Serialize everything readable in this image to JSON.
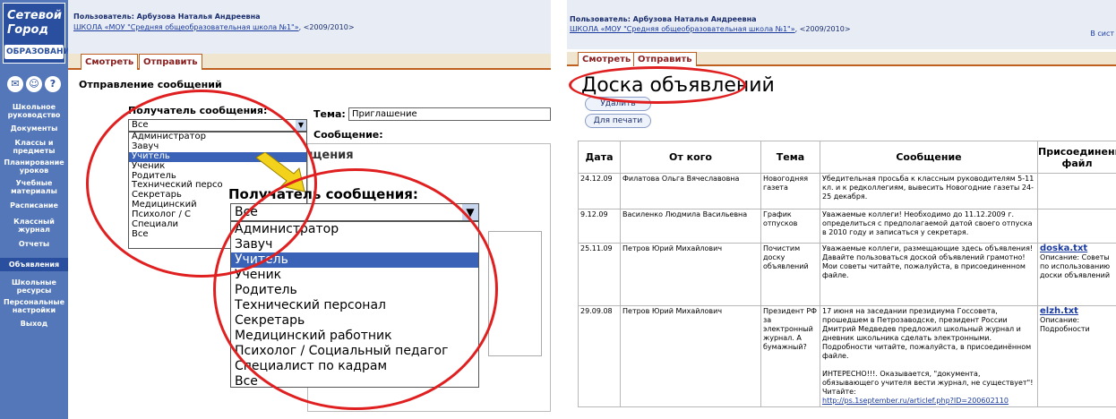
{
  "left": {
    "logo": {
      "line1": "Сетевой",
      "line2": "Город",
      "line3": "ОБРАЗОВАНИЕ"
    },
    "sidebar": {
      "icons": [
        "mail-icon",
        "users-icon",
        "help-icon"
      ],
      "items": [
        {
          "label": "Школьное руководство"
        },
        {
          "label": "Документы"
        },
        {
          "label": "Классы и предметы"
        },
        {
          "label": "Планирование уроков"
        },
        {
          "label": "Учебные материалы"
        },
        {
          "label": "Расписание"
        },
        {
          "label": "Классный журнал"
        },
        {
          "label": "Отчеты"
        },
        {
          "label": "Объявления"
        },
        {
          "label": "Школьные ресурсы"
        },
        {
          "label": "Персональные настройки"
        },
        {
          "label": "Выход"
        }
      ]
    },
    "header": {
      "user": "Пользователь: Арбузова Наталья Андреевна",
      "school_link": "ШКОЛА «МОУ \"Средняя общеобразовательная школа №1\"»",
      "year": ", <2009/2010>"
    },
    "tabs": [
      "Смотреть",
      "Отправить"
    ],
    "heading": "Отправление сообщений",
    "recipient_label": "Получатель сообщения:",
    "recipient_value": "Все",
    "recipient_options": [
      "Администратор",
      "Завуч",
      "Учитель",
      "Ученик",
      "Родитель",
      "Технический персо",
      "Секретарь",
      "Медицинский",
      "Психолог / С",
      "Специали",
      "Все"
    ],
    "theme_label": "Тема:",
    "theme_value": "Приглашение",
    "message_label": "Сообщение:",
    "partial_word": "щения",
    "zoom": {
      "label": "Получатель сообщения:",
      "value": "Все",
      "options": [
        "Администратор",
        "Завуч",
        "Учитель",
        "Ученик",
        "Родитель",
        "Технический персонал",
        "Секретарь",
        "Медицинский работник",
        "Психолог / Социальный педагог",
        "Специалист по кадрам",
        "Все"
      ]
    }
  },
  "right": {
    "header": {
      "user": "Пользователь: Арбузова Наталья Андреевна",
      "school_link": "ШКОЛА «МОУ \"Средняя общеобразовательная школа №1\"»",
      "year": ", <2009/2010>",
      "corner_text": "В сист"
    },
    "tabs": [
      "Смотреть",
      "Отправить"
    ],
    "title": "Доска объявлений",
    "buttons": {
      "delete": "Удалить",
      "print": "Для печати"
    },
    "columns": [
      "Дата",
      "От кого",
      "Тема",
      "Сообщение",
      "Присоединенный файл"
    ],
    "rows": [
      {
        "date": "24.12.09",
        "from": "Филатова Ольга Вячеславовна",
        "topic": "Новогодняя газета",
        "message": "Убедительная просьба к классным руководителям 5-11 кл. и к редколлегиям, вывесить Новогодние газеты 24-25 декабря.",
        "file": "",
        "file_note": ""
      },
      {
        "date": "9.12.09",
        "from": "Василенко Людмила Васильевна",
        "topic": "График отпусков",
        "message": "Уважаемые коллеги! Необходимо до 11.12.2009 г. определиться с предполагаемой датой своего отпуска в 2010 году и записаться у секретаря.",
        "file": "",
        "file_note": ""
      },
      {
        "date": "25.11.09",
        "from": "Петров Юрий Михайлович",
        "topic": "Почистим доску объявлений",
        "message": "Уважаемые коллеги, размещающие здесь объявления! Давайте пользоваться доской объявлений грамотно! Мои советы читайте, пожалуйста, в присоединенном файле.",
        "file": "doska.txt",
        "file_note": "Описание: Советы по использованию доски объявлений"
      },
      {
        "date": "29.09.08",
        "from": "Петров Юрий Михайлович",
        "topic": "Президент РФ за электронный журнал. А бумажный?",
        "message": "17 июня на заседании президиума Госсовета, прошедшем в Петрозаводске, президент России Дмитрий Медведев предложил школьный журнал и дневник школьника сделать электронными. Подробности читайте, пожалуйста, в присоединённом файле.",
        "message_extra": "ИНТЕРЕСНО!!!. Оказывается, \"документа, обязывающего учителя вести журнал, не существует\"! Читайте:",
        "message_link": "http://ps.1september.ru/articlef.php?ID=200602110",
        "file": "elzh.txt",
        "file_note": "Описание: Подробности"
      }
    ]
  },
  "colors": {
    "sidebar": "#5377b8",
    "accent_red": "#e02020",
    "tab_border": "#c06020",
    "selection": "#3a62b6",
    "arrow": "#f2d21a"
  }
}
